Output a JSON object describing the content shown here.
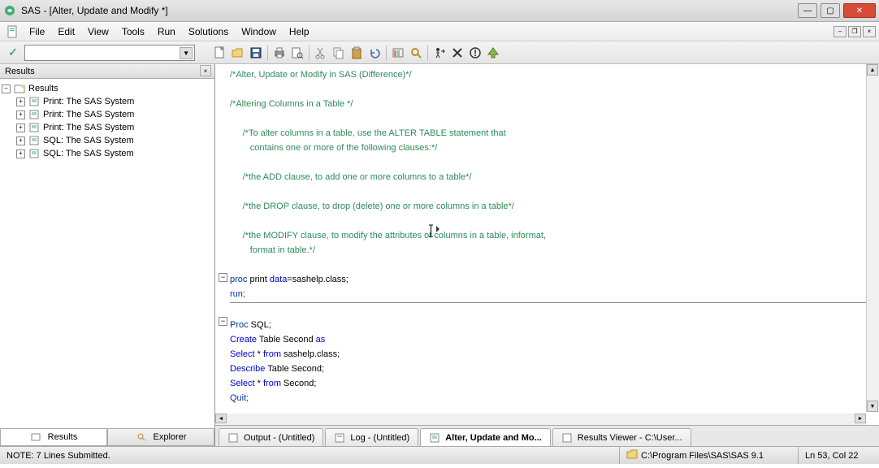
{
  "title": "SAS - [Alter, Update and Modify *]",
  "menus": [
    "File",
    "Edit",
    "View",
    "Tools",
    "Run",
    "Solutions",
    "Window",
    "Help"
  ],
  "left_panel": {
    "title": "Results",
    "root": "Results",
    "items": [
      "Print:  The SAS System",
      "Print:  The SAS System",
      "Print:  The SAS System",
      "SQL:  The SAS System",
      "SQL:  The SAS System"
    ],
    "tabs": {
      "results": "Results",
      "explorer": "Explorer"
    }
  },
  "code": {
    "l1": "/*Alter, Update or Modify in SAS (Difference)*/",
    "l2": "/*Altering Columns in a Table */",
    "l3": "/*To alter columns in a table, use the ALTER TABLE statement that",
    "l4": "   contains one or more of the following clauses:*/",
    "l5": "/*the ADD clause, to add one or more columns to a table*/",
    "l6": "/*the DROP clause, to drop (delete) one or more columns in a table*/",
    "l7": "/*the MODIFY clause, to modify the attributes of columns in a table, informat,",
    "l8": "   format in table.*/",
    "p1a": "proc",
    "p1b": " print ",
    "p1c": "data",
    "p1d": "=sashelp.class;",
    "p2": "run;",
    "s1a": "Proc",
    "s1b": " SQL;",
    "s2a": "Create",
    "s2b": " Table ",
    "s2c": "Second ",
    "s2d": "as",
    "s3a": "Select",
    "s3b": " * ",
    "s3c": "from",
    "s3d": " sashelp.class;",
    "s4a": "Describe",
    "s4b": " Table ",
    "s4c": "Second;",
    "s5a": "Select",
    "s5b": " * ",
    "s5c": "from",
    "s5d": " Second;",
    "s6": "Quit;"
  },
  "editor_tabs": [
    "Output - (Untitled)",
    "Log - (Untitled)",
    "Alter, Update and Mo...",
    "Results Viewer - C:\\User..."
  ],
  "status": {
    "note": "NOTE:  7 Lines Submitted.",
    "path": "C:\\Program Files\\SAS\\SAS 9.1",
    "pos": "Ln 53, Col 22"
  }
}
